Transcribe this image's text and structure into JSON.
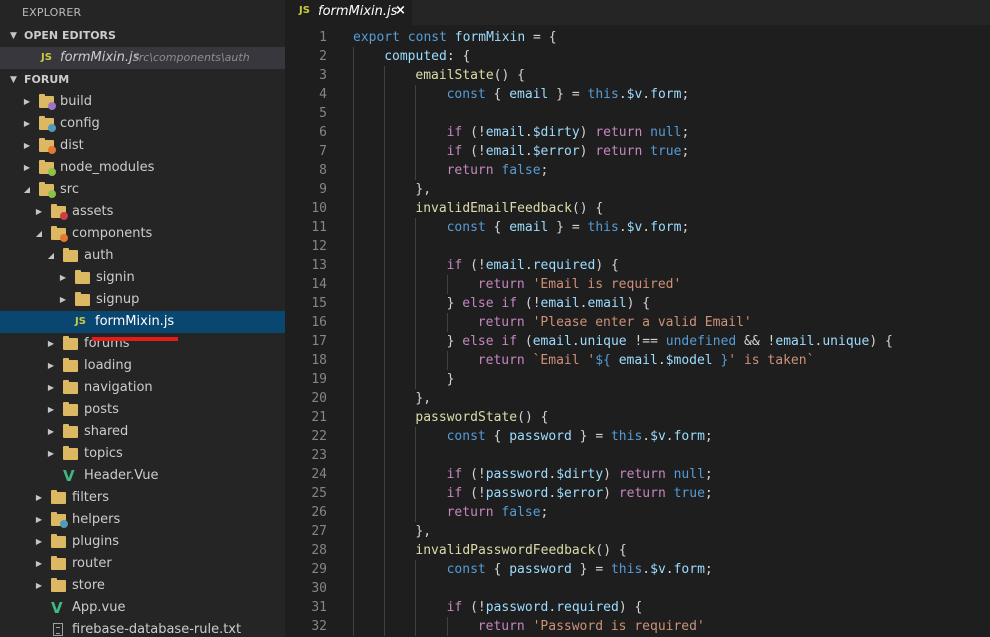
{
  "explorer": {
    "title": "EXPLORER",
    "open_editors": {
      "label": "OPEN EDITORS",
      "items": [
        {
          "icon": "JS",
          "name": "formMixin.js",
          "path": "src\\components\\auth"
        }
      ]
    },
    "project": {
      "label": "FORUM",
      "tree": [
        {
          "depth": 0,
          "arrow": "closed",
          "icon": "folder",
          "badge": "#a074c4",
          "label": "build"
        },
        {
          "depth": 0,
          "arrow": "closed",
          "icon": "folder",
          "badge": "#519aba",
          "label": "config"
        },
        {
          "depth": 0,
          "arrow": "closed",
          "icon": "folder",
          "badge": "#e37933",
          "label": "dist"
        },
        {
          "depth": 0,
          "arrow": "closed",
          "icon": "folder",
          "badge": "#8dc149",
          "label": "node_modules"
        },
        {
          "depth": 0,
          "arrow": "open",
          "icon": "folder",
          "badge": "#8dc149",
          "label": "src"
        },
        {
          "depth": 1,
          "arrow": "closed",
          "icon": "folder",
          "badge": "#cc3e44",
          "label": "assets"
        },
        {
          "depth": 1,
          "arrow": "open",
          "icon": "folder",
          "badge": "#e37933",
          "label": "components"
        },
        {
          "depth": 2,
          "arrow": "open",
          "icon": "folder",
          "badge": "",
          "label": "auth"
        },
        {
          "depth": 3,
          "arrow": "closed",
          "icon": "folder",
          "badge": "",
          "label": "signin"
        },
        {
          "depth": 3,
          "arrow": "closed",
          "icon": "folder",
          "badge": "",
          "label": "signup"
        },
        {
          "depth": 3,
          "arrow": "none",
          "icon": "js",
          "badge": "",
          "label": "formMixin.js",
          "selected": true
        },
        {
          "depth": 2,
          "arrow": "closed",
          "icon": "folder",
          "badge": "",
          "label": "forums"
        },
        {
          "depth": 2,
          "arrow": "closed",
          "icon": "folder",
          "badge": "",
          "label": "loading"
        },
        {
          "depth": 2,
          "arrow": "closed",
          "icon": "folder",
          "badge": "",
          "label": "navigation"
        },
        {
          "depth": 2,
          "arrow": "closed",
          "icon": "folder",
          "badge": "",
          "label": "posts"
        },
        {
          "depth": 2,
          "arrow": "closed",
          "icon": "folder",
          "badge": "",
          "label": "shared"
        },
        {
          "depth": 2,
          "arrow": "closed",
          "icon": "folder",
          "badge": "",
          "label": "topics"
        },
        {
          "depth": 2,
          "arrow": "none",
          "icon": "vue",
          "badge": "",
          "label": "Header.Vue"
        },
        {
          "depth": 1,
          "arrow": "closed",
          "icon": "folder",
          "badge": "",
          "label": "filters"
        },
        {
          "depth": 1,
          "arrow": "closed",
          "icon": "folder",
          "badge": "#519aba",
          "label": "helpers"
        },
        {
          "depth": 1,
          "arrow": "closed",
          "icon": "folder",
          "badge": "",
          "label": "plugins"
        },
        {
          "depth": 1,
          "arrow": "closed",
          "icon": "folder",
          "badge": "",
          "label": "router"
        },
        {
          "depth": 1,
          "arrow": "closed",
          "icon": "folder",
          "badge": "",
          "label": "store"
        },
        {
          "depth": 1,
          "arrow": "none",
          "icon": "vue",
          "badge": "",
          "label": "App.vue"
        },
        {
          "depth": 1,
          "arrow": "none",
          "icon": "txt",
          "badge": "",
          "label": "firebase-database-rule.txt"
        }
      ]
    }
  },
  "tab": {
    "icon": "JS",
    "name": "formMixin.js",
    "close": "×"
  },
  "editor": {
    "lines": [
      {
        "n": "1",
        "indent": 0,
        "tokens": [
          [
            "kw",
            "export"
          ],
          [
            "pu",
            " "
          ],
          [
            "kw",
            "const"
          ],
          [
            "pu",
            " "
          ],
          [
            "id",
            "formMixin"
          ],
          [
            "pu",
            " = {"
          ]
        ]
      },
      {
        "n": "2",
        "indent": 1,
        "tokens": [
          [
            "id",
            "computed"
          ],
          [
            "pu",
            ": {"
          ]
        ]
      },
      {
        "n": "3",
        "indent": 2,
        "tokens": [
          [
            "fn",
            "emailState"
          ],
          [
            "pu",
            "() {"
          ]
        ]
      },
      {
        "n": "4",
        "indent": 3,
        "tokens": [
          [
            "kw",
            "const"
          ],
          [
            "pu",
            " { "
          ],
          [
            "id",
            "email"
          ],
          [
            "pu",
            " } = "
          ],
          [
            "kw",
            "this"
          ],
          [
            "pu",
            "."
          ],
          [
            "id",
            "$v"
          ],
          [
            "pu",
            "."
          ],
          [
            "id",
            "form"
          ],
          [
            "pu",
            ";"
          ]
        ]
      },
      {
        "n": "5",
        "indent": 3,
        "tokens": []
      },
      {
        "n": "6",
        "indent": 3,
        "tokens": [
          [
            "ctl",
            "if"
          ],
          [
            "pu",
            " (!"
          ],
          [
            "id",
            "email"
          ],
          [
            "pu",
            "."
          ],
          [
            "id",
            "$dirty"
          ],
          [
            "pu",
            ") "
          ],
          [
            "ctl",
            "return"
          ],
          [
            "pu",
            " "
          ],
          [
            "kw",
            "null"
          ],
          [
            "pu",
            ";"
          ]
        ]
      },
      {
        "n": "7",
        "indent": 3,
        "tokens": [
          [
            "ctl",
            "if"
          ],
          [
            "pu",
            " (!"
          ],
          [
            "id",
            "email"
          ],
          [
            "pu",
            "."
          ],
          [
            "id",
            "$error"
          ],
          [
            "pu",
            ") "
          ],
          [
            "ctl",
            "return"
          ],
          [
            "pu",
            " "
          ],
          [
            "kw",
            "true"
          ],
          [
            "pu",
            ";"
          ]
        ]
      },
      {
        "n": "8",
        "indent": 3,
        "tokens": [
          [
            "ctl",
            "return"
          ],
          [
            "pu",
            " "
          ],
          [
            "kw",
            "false"
          ],
          [
            "pu",
            ";"
          ]
        ]
      },
      {
        "n": "9",
        "indent": 2,
        "tokens": [
          [
            "pu",
            "},"
          ]
        ]
      },
      {
        "n": "10",
        "indent": 2,
        "tokens": [
          [
            "fn",
            "invalidEmailFeedback"
          ],
          [
            "pu",
            "() {"
          ]
        ]
      },
      {
        "n": "11",
        "indent": 3,
        "tokens": [
          [
            "kw",
            "const"
          ],
          [
            "pu",
            " { "
          ],
          [
            "id",
            "email"
          ],
          [
            "pu",
            " } = "
          ],
          [
            "kw",
            "this"
          ],
          [
            "pu",
            "."
          ],
          [
            "id",
            "$v"
          ],
          [
            "pu",
            "."
          ],
          [
            "id",
            "form"
          ],
          [
            "pu",
            ";"
          ]
        ]
      },
      {
        "n": "12",
        "indent": 3,
        "tokens": []
      },
      {
        "n": "13",
        "indent": 3,
        "tokens": [
          [
            "ctl",
            "if"
          ],
          [
            "pu",
            " (!"
          ],
          [
            "id",
            "email"
          ],
          [
            "pu",
            "."
          ],
          [
            "id",
            "required"
          ],
          [
            "pu",
            ") {"
          ]
        ]
      },
      {
        "n": "14",
        "indent": 4,
        "tokens": [
          [
            "ctl",
            "return"
          ],
          [
            "pu",
            " "
          ],
          [
            "str",
            "'Email is required'"
          ]
        ]
      },
      {
        "n": "15",
        "indent": 3,
        "tokens": [
          [
            "pu",
            "} "
          ],
          [
            "ctl",
            "else"
          ],
          [
            "pu",
            " "
          ],
          [
            "ctl",
            "if"
          ],
          [
            "pu",
            " (!"
          ],
          [
            "id",
            "email"
          ],
          [
            "pu",
            "."
          ],
          [
            "id",
            "email"
          ],
          [
            "pu",
            ") {"
          ]
        ]
      },
      {
        "n": "16",
        "indent": 4,
        "tokens": [
          [
            "ctl",
            "return"
          ],
          [
            "pu",
            " "
          ],
          [
            "str",
            "'Please enter a valid Email'"
          ]
        ]
      },
      {
        "n": "17",
        "indent": 3,
        "tokens": [
          [
            "pu",
            "} "
          ],
          [
            "ctl",
            "else"
          ],
          [
            "pu",
            " "
          ],
          [
            "ctl",
            "if"
          ],
          [
            "pu",
            " ("
          ],
          [
            "id",
            "email"
          ],
          [
            "pu",
            "."
          ],
          [
            "id",
            "unique"
          ],
          [
            "pu",
            " !== "
          ],
          [
            "kw",
            "undefined"
          ],
          [
            "pu",
            " && !"
          ],
          [
            "id",
            "email"
          ],
          [
            "pu",
            "."
          ],
          [
            "id",
            "unique"
          ],
          [
            "pu",
            ") {"
          ]
        ]
      },
      {
        "n": "18",
        "indent": 4,
        "tokens": [
          [
            "ctl",
            "return"
          ],
          [
            "pu",
            " "
          ],
          [
            "str",
            "`Email '"
          ],
          [
            "kw",
            "${"
          ],
          [
            "pu",
            " "
          ],
          [
            "id",
            "email"
          ],
          [
            "pu",
            "."
          ],
          [
            "id",
            "$model"
          ],
          [
            "pu",
            " "
          ],
          [
            "kw",
            "}"
          ],
          [
            "str",
            "' is taken`"
          ]
        ]
      },
      {
        "n": "19",
        "indent": 3,
        "tokens": [
          [
            "pu",
            "}"
          ]
        ]
      },
      {
        "n": "20",
        "indent": 2,
        "tokens": [
          [
            "pu",
            "},"
          ]
        ]
      },
      {
        "n": "21",
        "indent": 2,
        "tokens": [
          [
            "fn",
            "passwordState"
          ],
          [
            "pu",
            "() {"
          ]
        ]
      },
      {
        "n": "22",
        "indent": 3,
        "tokens": [
          [
            "kw",
            "const"
          ],
          [
            "pu",
            " { "
          ],
          [
            "id",
            "password"
          ],
          [
            "pu",
            " } = "
          ],
          [
            "kw",
            "this"
          ],
          [
            "pu",
            "."
          ],
          [
            "id",
            "$v"
          ],
          [
            "pu",
            "."
          ],
          [
            "id",
            "form"
          ],
          [
            "pu",
            ";"
          ]
        ]
      },
      {
        "n": "23",
        "indent": 3,
        "tokens": []
      },
      {
        "n": "24",
        "indent": 3,
        "tokens": [
          [
            "ctl",
            "if"
          ],
          [
            "pu",
            " (!"
          ],
          [
            "id",
            "password"
          ],
          [
            "pu",
            "."
          ],
          [
            "id",
            "$dirty"
          ],
          [
            "pu",
            ") "
          ],
          [
            "ctl",
            "return"
          ],
          [
            "pu",
            " "
          ],
          [
            "kw",
            "null"
          ],
          [
            "pu",
            ";"
          ]
        ]
      },
      {
        "n": "25",
        "indent": 3,
        "tokens": [
          [
            "ctl",
            "if"
          ],
          [
            "pu",
            " (!"
          ],
          [
            "id",
            "password"
          ],
          [
            "pu",
            "."
          ],
          [
            "id",
            "$error"
          ],
          [
            "pu",
            ") "
          ],
          [
            "ctl",
            "return"
          ],
          [
            "pu",
            " "
          ],
          [
            "kw",
            "true"
          ],
          [
            "pu",
            ";"
          ]
        ]
      },
      {
        "n": "26",
        "indent": 3,
        "tokens": [
          [
            "ctl",
            "return"
          ],
          [
            "pu",
            " "
          ],
          [
            "kw",
            "false"
          ],
          [
            "pu",
            ";"
          ]
        ]
      },
      {
        "n": "27",
        "indent": 2,
        "tokens": [
          [
            "pu",
            "},"
          ]
        ]
      },
      {
        "n": "28",
        "indent": 2,
        "tokens": [
          [
            "fn",
            "invalidPasswordFeedback"
          ],
          [
            "pu",
            "() {"
          ]
        ]
      },
      {
        "n": "29",
        "indent": 3,
        "tokens": [
          [
            "kw",
            "const"
          ],
          [
            "pu",
            " { "
          ],
          [
            "id",
            "password"
          ],
          [
            "pu",
            " } = "
          ],
          [
            "kw",
            "this"
          ],
          [
            "pu",
            "."
          ],
          [
            "id",
            "$v"
          ],
          [
            "pu",
            "."
          ],
          [
            "id",
            "form"
          ],
          [
            "pu",
            ";"
          ]
        ]
      },
      {
        "n": "30",
        "indent": 3,
        "tokens": []
      },
      {
        "n": "31",
        "indent": 3,
        "tokens": [
          [
            "ctl",
            "if"
          ],
          [
            "pu",
            " (!"
          ],
          [
            "id",
            "password"
          ],
          [
            "pu",
            "."
          ],
          [
            "id",
            "required"
          ],
          [
            "pu",
            ") {"
          ]
        ]
      },
      {
        "n": "32",
        "indent": 4,
        "tokens": [
          [
            "ctl",
            "return"
          ],
          [
            "pu",
            " "
          ],
          [
            "str",
            "'Password is required'"
          ]
        ]
      }
    ]
  },
  "colors": {
    "sidebar_bg": "#252526",
    "editor_bg": "#1e1e1e",
    "selection_bg": "#094771",
    "folder": "#dcb862",
    "annotation_underline": "#e51b1b"
  }
}
